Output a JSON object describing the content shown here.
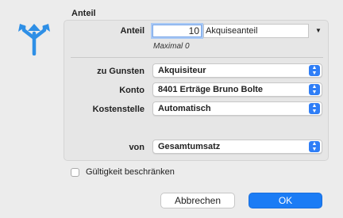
{
  "group": {
    "title": "Anteil"
  },
  "share": {
    "label": "Anteil",
    "value": "10",
    "type_value": "Akquiseanteil",
    "hint": "Maximal 0",
    "dropdown_icon": "triangle-down-icon"
  },
  "fields": {
    "zu_gunsten": {
      "label": "zu Gunsten",
      "value": "Akquisiteur"
    },
    "konto": {
      "label": "Konto",
      "value": "8401 Erträge Bruno Bolte"
    },
    "kostenstelle": {
      "label": "Kostenstelle",
      "value": "Automatisch"
    },
    "von": {
      "label": "von",
      "value": "Gesamtumsatz"
    }
  },
  "validity": {
    "label": "Gültigkeit beschränken",
    "checked": false
  },
  "buttons": {
    "cancel": "Abbrechen",
    "ok": "OK"
  },
  "icons": {
    "dialog_icon": "split-arrows-icon",
    "popup_icon": "updown-chevron-icon"
  },
  "colors": {
    "accent": "#1b7cf5",
    "icon_blue": "#2e8fe6"
  }
}
